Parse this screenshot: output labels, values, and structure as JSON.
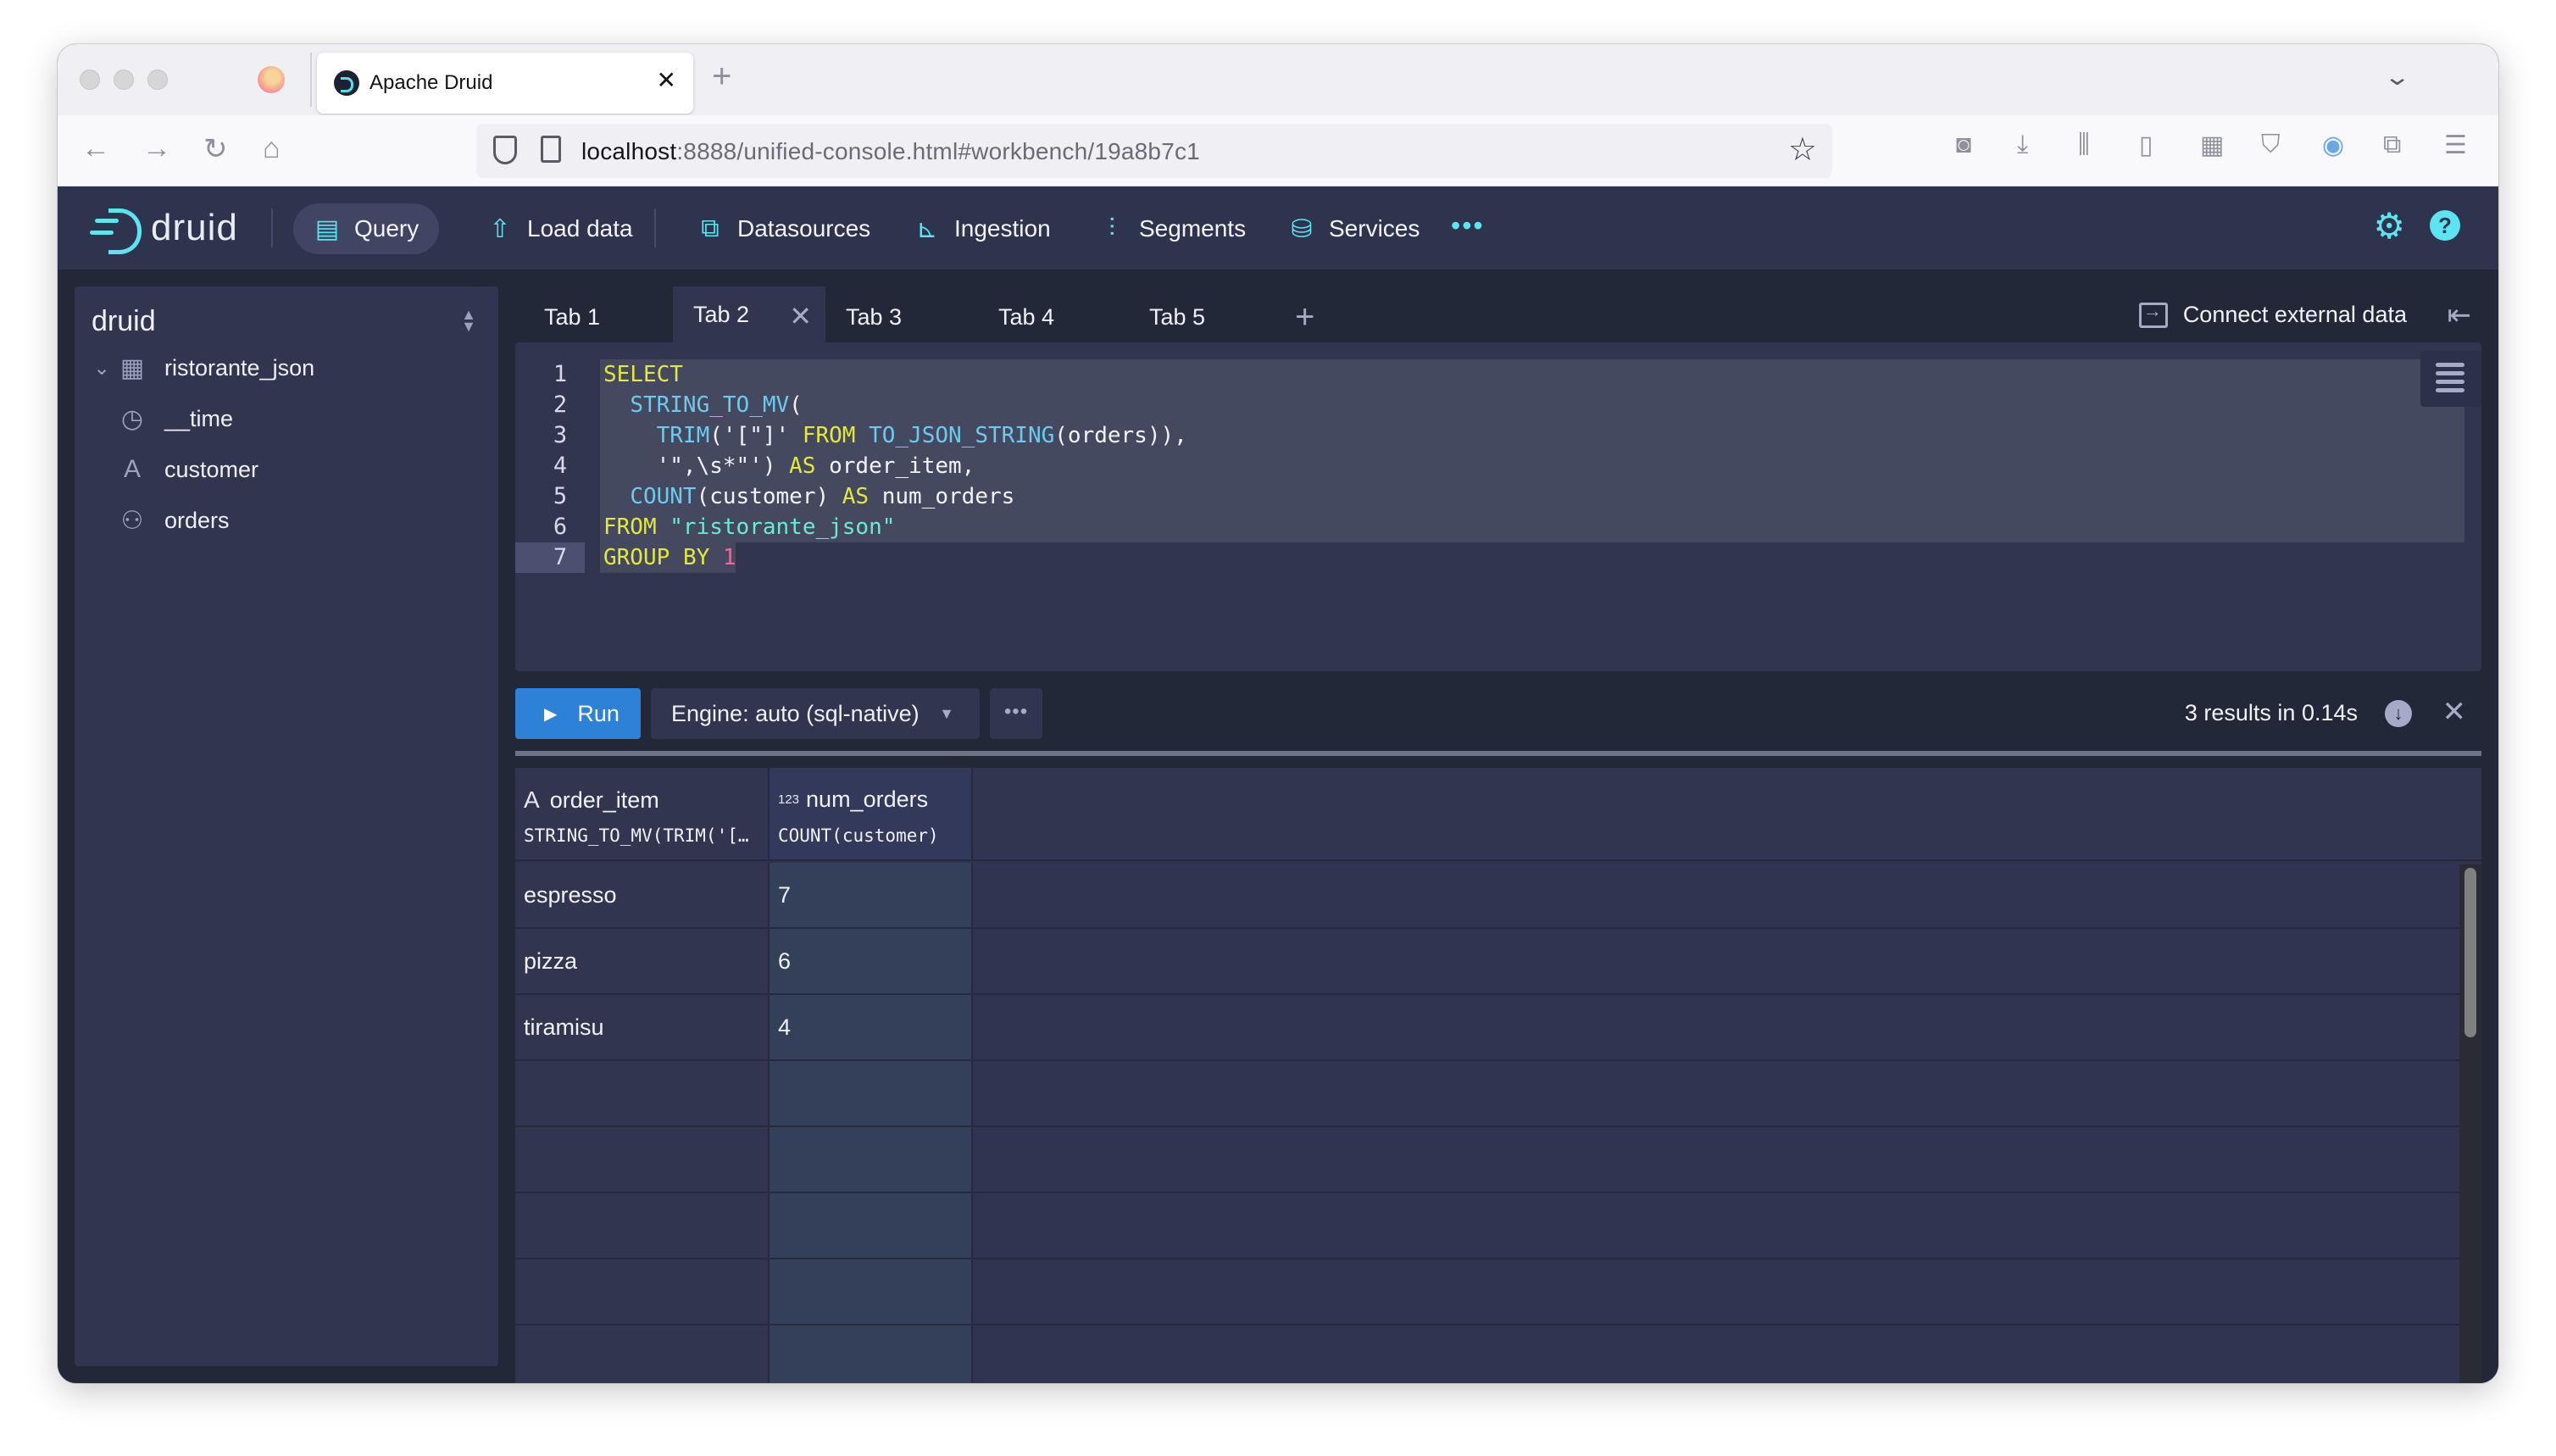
{
  "browser": {
    "tab_title": "Apache Druid",
    "url_host": "localhost",
    "url_rest": ":8888/unified-console.html#workbench/19a8b7c1",
    "icons": [
      "back-icon",
      "forward-icon",
      "reload-icon",
      "home-icon",
      "shield-icon",
      "page-icon",
      "bookmark-star-icon",
      "pocket-icon",
      "download-icon",
      "library-icon",
      "sidebar-icon",
      "extension-grid-icon",
      "privacy-badger-icon",
      "password-manager-icon",
      "extensions-icon",
      "menu-icon"
    ]
  },
  "nav": {
    "logo_text": "druid",
    "items": [
      {
        "label": "Query",
        "icon": "query-icon",
        "active": true
      },
      {
        "label": "Load data",
        "icon": "upload-icon"
      },
      {
        "label": "Datasources",
        "icon": "datasources-icon"
      },
      {
        "label": "Ingestion",
        "icon": "ingestion-icon"
      },
      {
        "label": "Segments",
        "icon": "segments-icon"
      },
      {
        "label": "Services",
        "icon": "database-icon"
      }
    ],
    "more": "•••"
  },
  "sidebar": {
    "title": "druid",
    "datasource": "ristorante_json",
    "columns": [
      {
        "name": "__time",
        "type": "time"
      },
      {
        "name": "customer",
        "type": "string"
      },
      {
        "name": "orders",
        "type": "complex"
      }
    ]
  },
  "query_tabs": {
    "tabs": [
      "Tab 1",
      "Tab 2",
      "Tab 3",
      "Tab 4",
      "Tab 5"
    ],
    "active_index": 1,
    "connect_label": "Connect external data"
  },
  "editor": {
    "line_numbers": [
      "1",
      "2",
      "3",
      "4",
      "5",
      "6",
      "7"
    ],
    "active_line": 7,
    "lines": [
      "SELECT",
      "  STRING_TO_MV(",
      "    TRIM('[\"]' FROM TO_JSON_STRING(orders)),",
      "    '\",\\s*\"') AS order_item,",
      "  COUNT(customer) AS num_orders",
      "FROM \"ristorante_json\"",
      "GROUP BY 1"
    ]
  },
  "run_bar": {
    "run_label": "Run",
    "engine_label": "Engine: auto (sql-native)",
    "more_label": "•••",
    "result_info": "3 results in 0.14s"
  },
  "results": {
    "columns": [
      {
        "name": "order_item",
        "type_icon": "A",
        "expression": "STRING_TO_MV(TRIM('[…"
      },
      {
        "name": "num_orders",
        "type_icon": "123",
        "expression": "COUNT(customer)"
      }
    ],
    "rows": [
      [
        "espresso",
        "7"
      ],
      [
        "pizza",
        "6"
      ],
      [
        "tiramisu",
        "4"
      ]
    ]
  },
  "colors": {
    "accent": "#5ce4f0",
    "run_button": "#2d82d8",
    "nav_bg": "#2f344e",
    "content_bg": "#232838",
    "keyword": "#e2e83c",
    "function": "#6ec9ec",
    "string": "#6ee8d8",
    "number": "#e86aa0"
  }
}
